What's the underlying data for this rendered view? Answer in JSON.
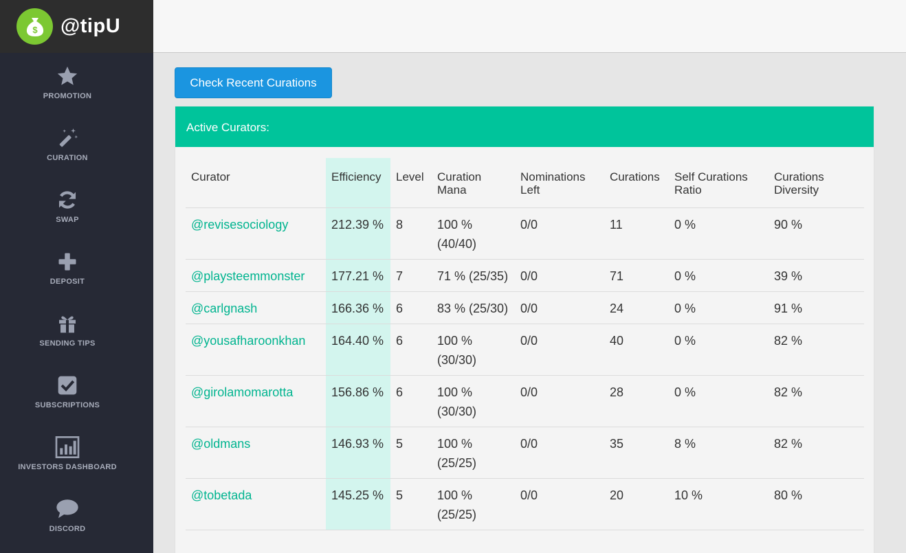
{
  "brand": {
    "name": "@tipU"
  },
  "colors": {
    "accent": "#00c49b",
    "button": "#1b95e0",
    "link": "#00b48f",
    "sidebar": "#262935",
    "highlight": "#d3f5ee"
  },
  "nav": [
    {
      "label": "PROMOTION",
      "icon": "star-icon"
    },
    {
      "label": "CURATION",
      "icon": "magic-wand-icon"
    },
    {
      "label": "SWAP",
      "icon": "refresh-icon"
    },
    {
      "label": "DEPOSIT",
      "icon": "plus-icon"
    },
    {
      "label": "SENDING TIPS",
      "icon": "gift-icon"
    },
    {
      "label": "SUBSCRIPTIONS",
      "icon": "checkbox-icon"
    },
    {
      "label": "INVESTORS DASHBOARD",
      "icon": "bar-chart-icon"
    },
    {
      "label": "DISCORD",
      "icon": "chat-bubble-icon"
    }
  ],
  "main": {
    "check_button": "Check Recent Curations",
    "panel_title": "Active Curators:",
    "columns": [
      "Curator",
      "Efficiency",
      "Level",
      "Curation Mana",
      "Nominations Left",
      "Curations",
      "Self Curations Ratio",
      "Curations Diversity"
    ],
    "rows": [
      {
        "curator": "@revisesociology",
        "efficiency": "212.39 %",
        "level": "8",
        "mana": "100 % (40/40)",
        "nominations": "0/0",
        "curations": "11",
        "self_ratio": "0 %",
        "diversity": "90 %"
      },
      {
        "curator": "@playsteemmonster",
        "efficiency": "177.21 %",
        "level": "7",
        "mana": "71 % (25/35)",
        "nominations": "0/0",
        "curations": "71",
        "self_ratio": "0 %",
        "diversity": "39 %"
      },
      {
        "curator": "@carlgnash",
        "efficiency": "166.36 %",
        "level": "6",
        "mana": "83 % (25/30)",
        "nominations": "0/0",
        "curations": "24",
        "self_ratio": "0 %",
        "diversity": "91 %"
      },
      {
        "curator": "@yousafharoonkhan",
        "efficiency": "164.40 %",
        "level": "6",
        "mana": "100 % (30/30)",
        "nominations": "0/0",
        "curations": "40",
        "self_ratio": "0 %",
        "diversity": "82 %"
      },
      {
        "curator": "@girolamomarotta",
        "efficiency": "156.86 %",
        "level": "6",
        "mana": "100 % (30/30)",
        "nominations": "0/0",
        "curations": "28",
        "self_ratio": "0 %",
        "diversity": "82 %"
      },
      {
        "curator": "@oldmans",
        "efficiency": "146.93 %",
        "level": "5",
        "mana": "100 % (25/25)",
        "nominations": "0/0",
        "curations": "35",
        "self_ratio": "8 %",
        "diversity": "82 %"
      },
      {
        "curator": "@tobetada",
        "efficiency": "145.25 %",
        "level": "5",
        "mana": "100 % (25/25)",
        "nominations": "0/0",
        "curations": "20",
        "self_ratio": "10 %",
        "diversity": "80 %"
      }
    ]
  }
}
